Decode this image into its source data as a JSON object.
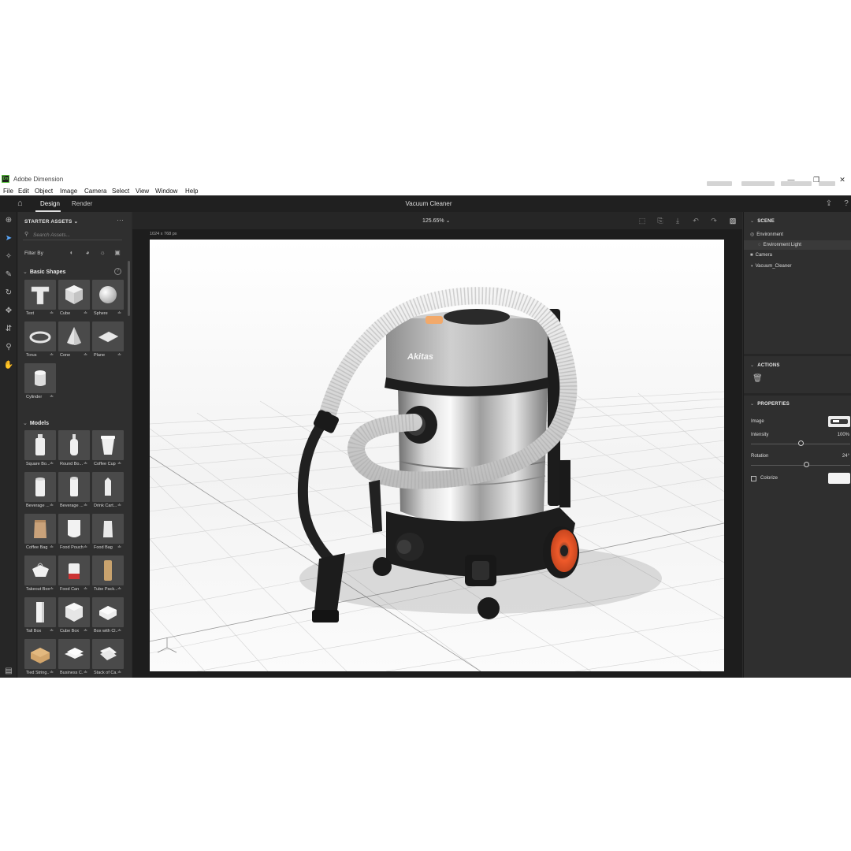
{
  "window": {
    "logo_text": "Dn",
    "title": "Adobe Dimension",
    "controls": {
      "minimize": "—",
      "maximize": "❐",
      "close": "✕"
    }
  },
  "menu": [
    "File",
    "Edit",
    "Object",
    "Image",
    "Camera",
    "Select",
    "View",
    "Window",
    "Help"
  ],
  "header": {
    "tabs": [
      {
        "label": "Design",
        "active": true
      },
      {
        "label": "Render",
        "active": false
      }
    ],
    "document_title": "Vacuum Cleaner"
  },
  "assets_panel": {
    "title": "STARTER ASSETS",
    "search_placeholder": "Search Assets...",
    "filter_label": "Filter By",
    "sections": [
      {
        "title": "Basic Shapes",
        "items": [
          "Text",
          "Cube",
          "Sphere",
          "Torus",
          "Cone",
          "Plane",
          "Cylinder"
        ]
      },
      {
        "title": "Models",
        "items": [
          "Square Bo...",
          "Round Bo...",
          "Coffee Cup",
          "Beverage ...",
          "Beverage ...",
          "Drink Cart...",
          "Coffee Bag",
          "Food Pouch",
          "Food Bag",
          "Takeout Box",
          "Food Can",
          "Tube Pack...",
          "Tall Box",
          "Cube Box",
          "Box with Cl...",
          "Tied String...",
          "Business C...",
          "Stack of Ca..."
        ]
      }
    ]
  },
  "canvas": {
    "zoom": "125.65%",
    "dimensions": "1024 x 768 px",
    "product_brand": "Akitas"
  },
  "right_panel": {
    "scene": {
      "title": "SCENE",
      "items": [
        {
          "label": "Environment",
          "icon": "environment-icon"
        },
        {
          "label": "Environment Light",
          "icon": "light-icon",
          "selected": true
        },
        {
          "label": "Camera",
          "icon": "camera-icon"
        },
        {
          "label": "Vacuum_Cleaner",
          "icon": "model-icon"
        }
      ]
    },
    "actions": {
      "title": "ACTIONS"
    },
    "properties": {
      "title": "PROPERTIES",
      "image_label": "Image",
      "intensity_label": "Intensity",
      "intensity_value": "100%",
      "intensity_level": 0.5,
      "rotation_label": "Rotation",
      "rotation_value": "24°",
      "rotation_level": 0.56,
      "colorize_label": "Colorize",
      "colorize_checked": false,
      "colorize_color": "#f4f4f4"
    }
  },
  "colors": {
    "accent": "#5aa9ff",
    "panel": "#2f2f2f",
    "wheel": "#e8542a"
  }
}
